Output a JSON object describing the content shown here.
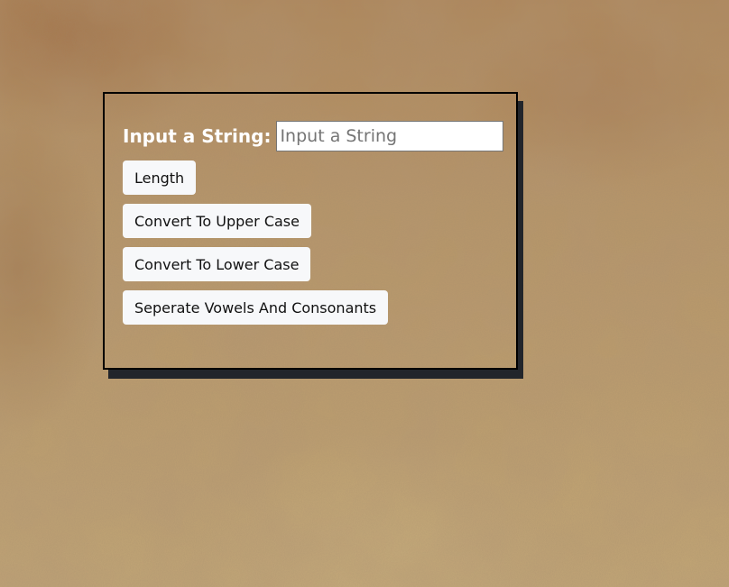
{
  "form": {
    "input_label": "Input a String:",
    "input_placeholder": "Input a String",
    "input_value": ""
  },
  "buttons": {
    "length": "Length",
    "upper_case": "Convert To Upper Case",
    "lower_case": "Convert To Lower Case",
    "separate": "Seperate Vowels And Consonants"
  },
  "colors": {
    "background": "#b89668",
    "card_border": "#000000",
    "card_shadow": "#22252b",
    "label_text": "#ffffff",
    "button_bg": "#f7f8fa"
  }
}
